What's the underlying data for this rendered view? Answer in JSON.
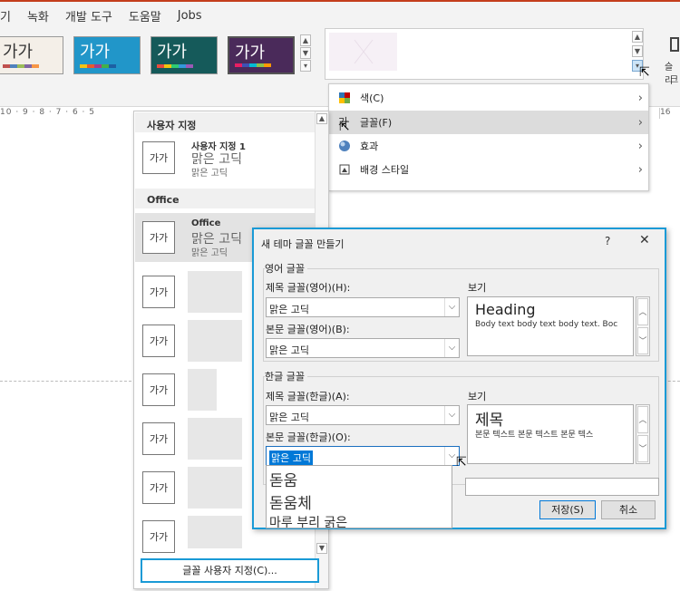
{
  "menubar": {
    "items": [
      "기",
      "녹화",
      "개발 도구",
      "도움말",
      "Jobs"
    ]
  },
  "themes": {
    "thumbs": [
      {
        "label": "가가",
        "bg": "#f4efe8",
        "fg": "#333333"
      },
      {
        "label": "가가",
        "bg": "#2196c9",
        "fg": "#ffffff"
      },
      {
        "label": "가가",
        "bg": "#155a5a",
        "fg": "#ffffff"
      },
      {
        "label": "가가",
        "bg": "#4a2a5a",
        "fg": "#ffffff"
      }
    ]
  },
  "ribbon_right": {
    "label1": "슬리",
    "label2": "크"
  },
  "ruler": {
    "left": "10 · 9 · 8 · 7 · 6 · 5",
    "right": "16"
  },
  "variant_menu": {
    "items": [
      {
        "icon": "color-palette-icon",
        "label": "색(C)"
      },
      {
        "icon": "font-icon",
        "label": "글꼴(F)"
      },
      {
        "icon": "effects-icon",
        "label": "효과"
      },
      {
        "icon": "background-style-icon",
        "label": "배경 스타일"
      }
    ]
  },
  "font_panel": {
    "custom_header": "사용자 지정",
    "custom_item": {
      "sample": "가가",
      "name": "사용자 지정 1",
      "heading_font": "맑은 고딕",
      "body_font": "맑은 고딕"
    },
    "office_header": "Office",
    "office_item": {
      "sample": "가가",
      "name": "Office",
      "heading_font": "맑은 고딕",
      "body_font": "맑은 고딕"
    },
    "blurred_samples": [
      "가가",
      "가가",
      "가가",
      "가가",
      "가가",
      "가가"
    ],
    "customize_button": "글꼴 사용자 지정(C)..."
  },
  "dialog": {
    "title": "새 테마 글꼴 만들기",
    "help": "?",
    "close": "✕",
    "latin_group": "영어 글꼴",
    "latin_heading_label": "제목 글꼴(영어)(H):",
    "latin_heading_value": "맑은 고딕",
    "latin_body_label": "본문 글꼴(영어)(B):",
    "latin_body_value": "맑은 고딕",
    "latin_preview_label": "보기",
    "latin_preview_heading": "Heading",
    "latin_preview_body": "Body text body text body text. Boc",
    "korean_group": "한글 글꼴",
    "korean_heading_label": "제목 글꼴(한글)(A):",
    "korean_heading_value": "맑은 고딕",
    "korean_body_label": "본문 글꼴(한글)(O):",
    "korean_body_value": "맑은 고딕",
    "korean_preview_label": "보기",
    "korean_preview_heading": "제목",
    "korean_preview_body": "본문 텍스트 본문 텍스트 본문 텍스",
    "dropdown_options": [
      "돋움",
      "돋움체",
      "마루 부리 굵은"
    ],
    "save_button": "저장(S)",
    "cancel_button": "취소"
  }
}
